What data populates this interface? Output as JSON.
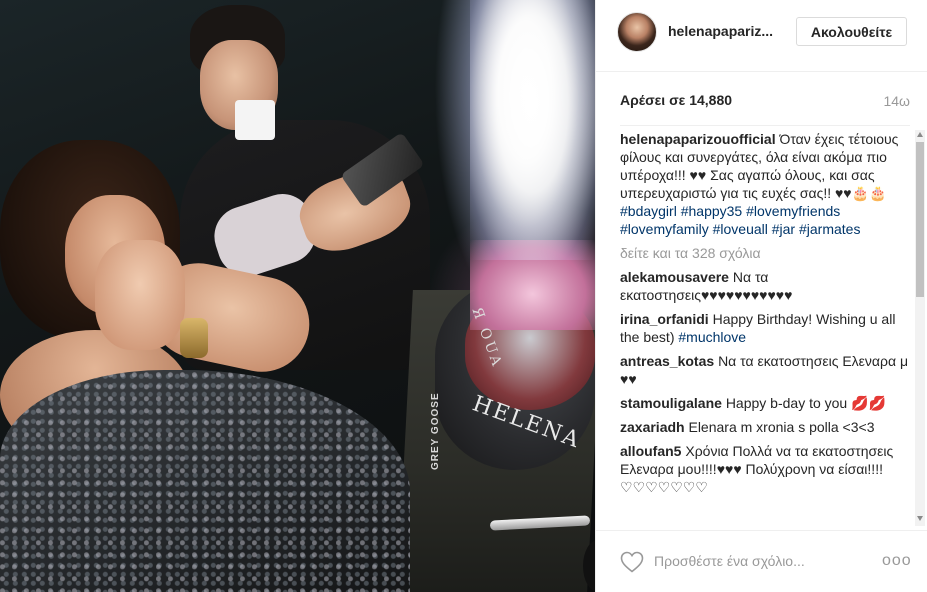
{
  "post": {
    "username": "helenapapariz...",
    "follow_label": "Ακολουθείτε",
    "likes": "Αρέσει σε 14,880",
    "time": "14ω",
    "image_texts": {
      "cake_name": "HELENA",
      "cake_small": "Я ОUA",
      "table_brand": "GREY GOOSE"
    }
  },
  "caption": {
    "author": "helenapaparizouofficial",
    "text": "Όταν έχεις τέτοιους φίλους και συνεργάτες, όλα είναι ακόμα πιο υπέροχα!!! ♥♥ Σας αγαπώ όλους, και σας υπερευχαριστώ για τις ευχές σας!! ♥♥🎂🎂",
    "tags": [
      "#bdaygirl",
      "#happy35",
      "#lovemyfriends",
      "#lovemyfamily",
      "#loveuall",
      "#jar",
      "#jarmates"
    ]
  },
  "load_more": "δείτε και τα 328 σχόλια",
  "comments": [
    {
      "author": "alekamousavere",
      "text": "Να τα εκατοστησεις♥♥♥♥♥♥♥♥♥♥♥",
      "tag": ""
    },
    {
      "author": "irina_orfanidi",
      "text": "Happy Birthday! Wishing u all the best)",
      "tag": "#muchlove"
    },
    {
      "author": "antreas_kotas",
      "text": "Να τα εκατοστησεις Ελεναρα μ ♥♥",
      "tag": ""
    },
    {
      "author": "stamouligalane",
      "text": "Happy b-day to you 💋💋",
      "tag": ""
    },
    {
      "author": "zaxariadh",
      "text": "Elenara m xronia s polla <3<3",
      "tag": ""
    },
    {
      "author": "alloufan5",
      "text": "Χρόνια Πολλά να τα εκατοστησεις Ελεναρα μου!!!!♥♥♥ Πολύχρονη να είσαι!!!!♡♡♡♡♡♡♡",
      "tag": ""
    }
  ],
  "footer": {
    "comment_placeholder": "Προσθέστε ένα σχόλιο...",
    "more_label": "ooo"
  },
  "colors": {
    "hashtag": "#003569",
    "muted": "#999999",
    "border": "#efefef"
  },
  "icons": {
    "like": "heart-outline-icon",
    "more": "ellipsis-icon"
  }
}
